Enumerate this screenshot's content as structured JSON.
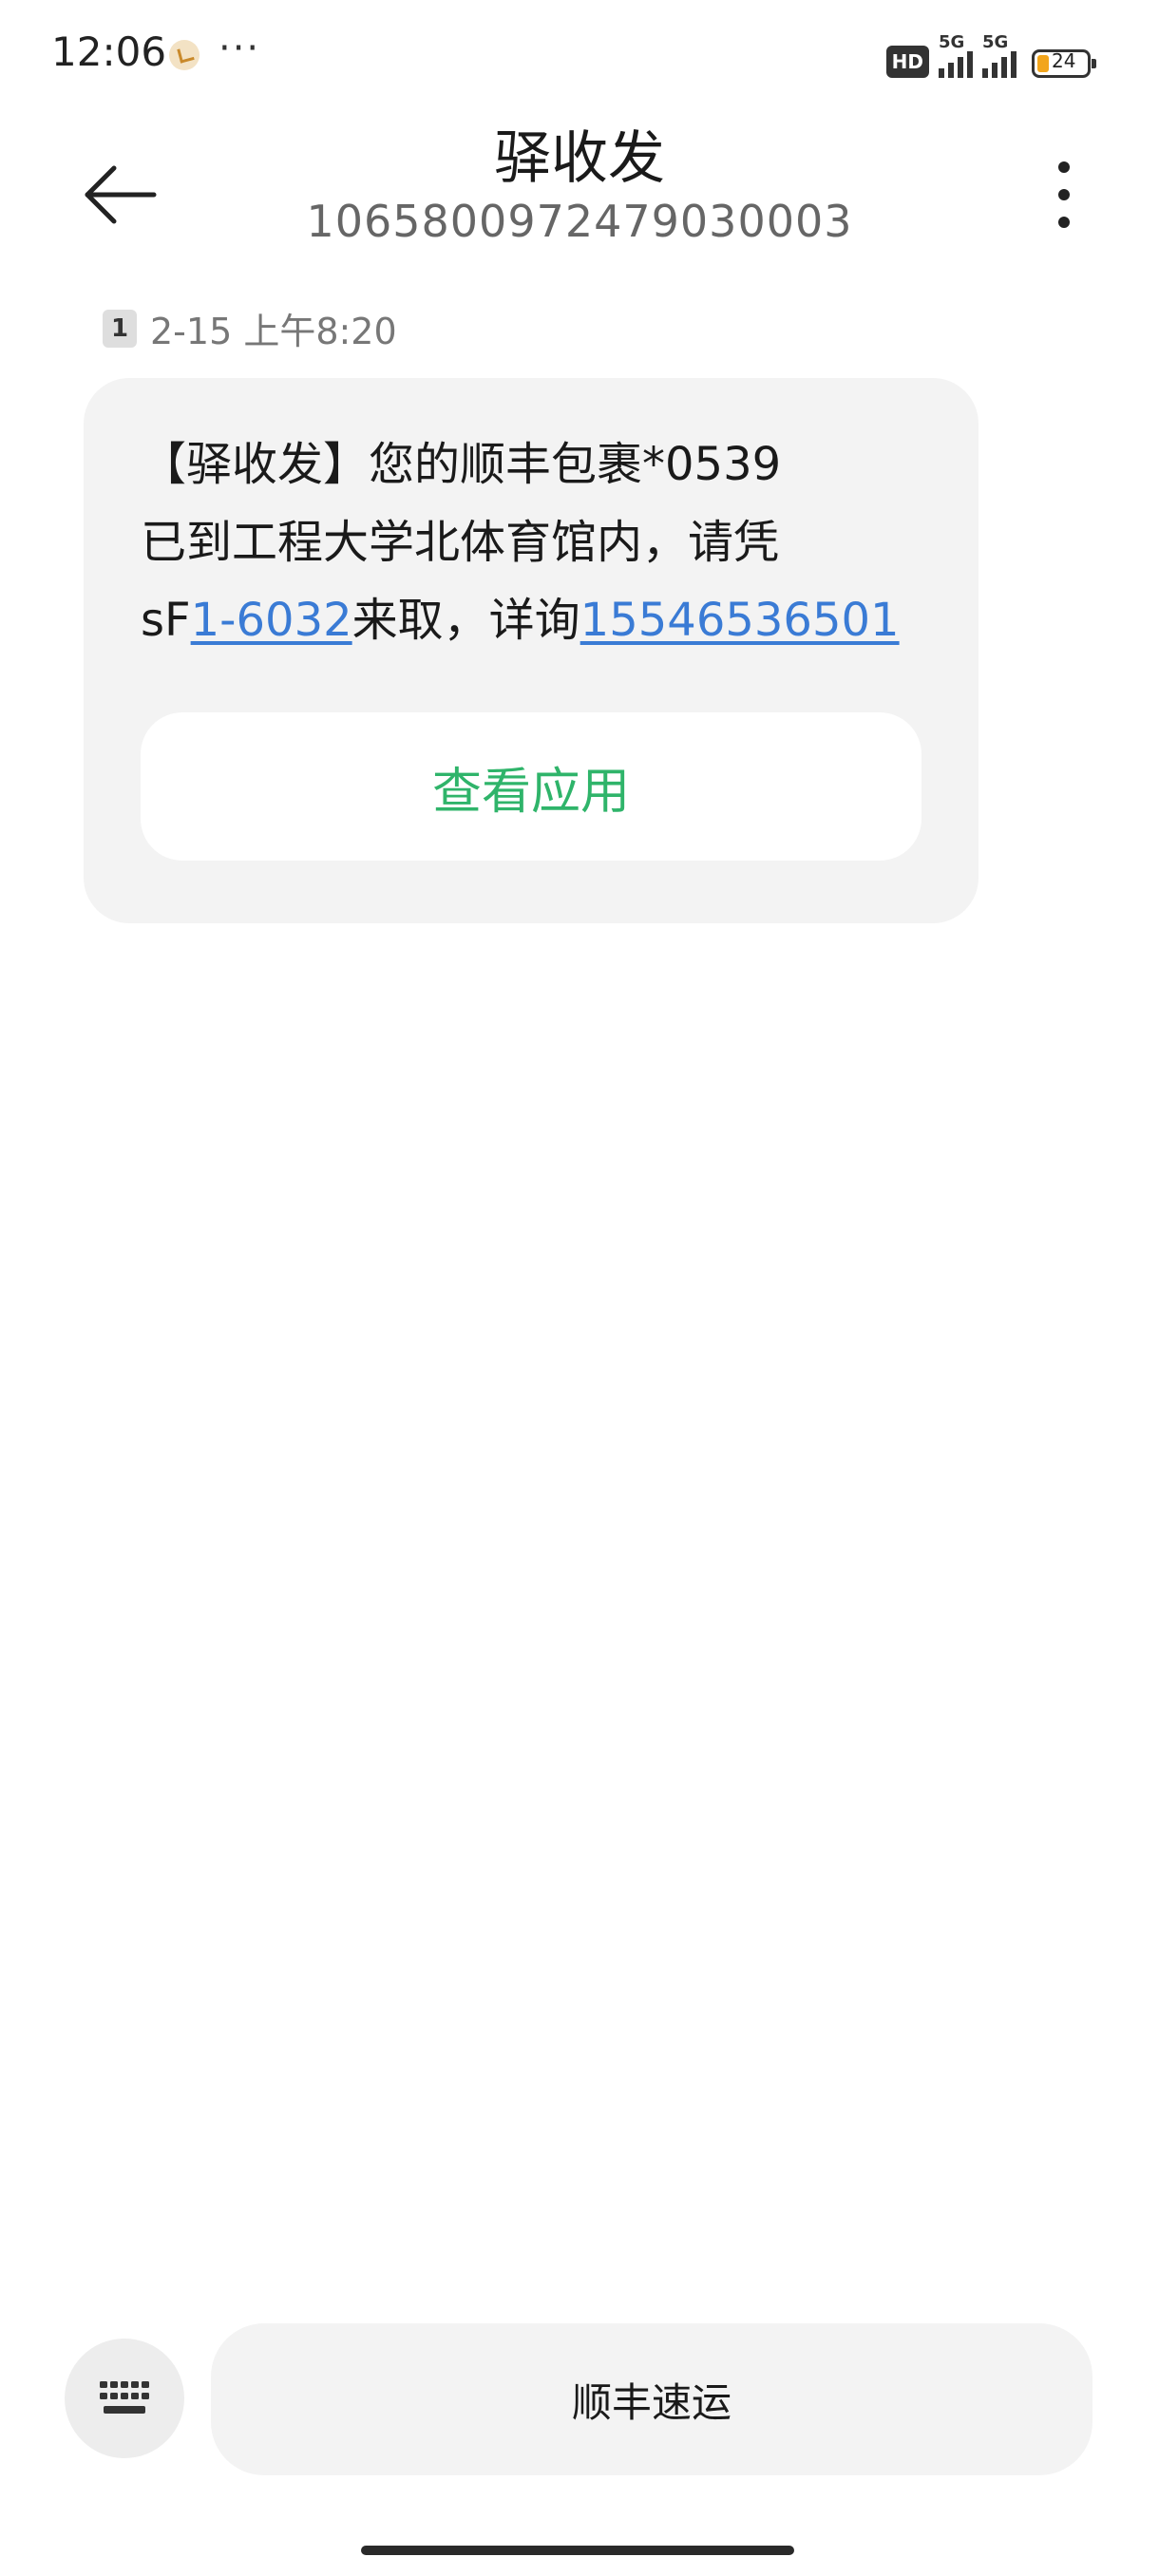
{
  "status_bar": {
    "time": "12:06",
    "more": "···",
    "hd": "HD",
    "network_1": "5G",
    "network_2": "5G",
    "battery": "24"
  },
  "header": {
    "title": "驿收发",
    "sender_number": "1065800972479030003"
  },
  "message": {
    "sim": "1",
    "time": "2-15 上午8:20",
    "line1": "【驿收发】您的顺丰包裹*0539",
    "line2": "已到工程大学北体育馆内，请凭",
    "line3_prefix": "sF",
    "pickup_code": "1-6032",
    "line3_middle": "来取，详询",
    "phone": "15546536501",
    "action_label": "查看应用"
  },
  "bottom_bar": {
    "quick_reply": "顺丰速运"
  },
  "colors": {
    "link": "#3a7bd5",
    "action": "#2fb46a",
    "bubble": "#f3f3f3"
  }
}
